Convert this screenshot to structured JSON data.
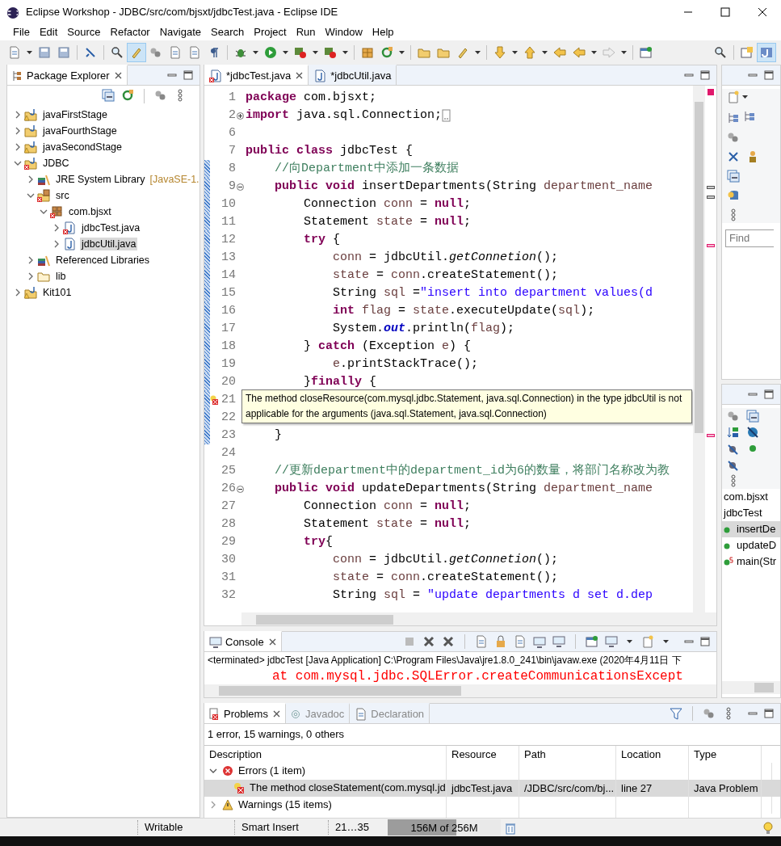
{
  "window": {
    "title": "Eclipse Workshop - JDBC/src/com/bjsxt/jdbcTest.java - Eclipse IDE"
  },
  "menu": [
    "File",
    "Edit",
    "Source",
    "Refactor",
    "Navigate",
    "Search",
    "Project",
    "Run",
    "Window",
    "Help"
  ],
  "package_explorer": {
    "title": "Package Explorer",
    "tree": [
      {
        "label": "javaFirstStage",
        "kind": "project",
        "error": false,
        "warning": true,
        "expanded": false,
        "selected": false
      },
      {
        "label": "javaFourthStage",
        "kind": "project",
        "error": false,
        "warning": false,
        "expanded": false,
        "selected": false
      },
      {
        "label": "javaSecondStage",
        "kind": "project",
        "error": false,
        "warning": true,
        "expanded": false,
        "selected": false
      },
      {
        "label": "JDBC",
        "kind": "project",
        "error": true,
        "warning": false,
        "expanded": true,
        "selected": false,
        "children": [
          {
            "label": "JRE System Library",
            "suffix": "[JavaSE-1.",
            "kind": "library",
            "error": false,
            "warning": false,
            "expanded": false,
            "selected": false
          },
          {
            "label": "src",
            "kind": "source",
            "error": true,
            "warning": false,
            "expanded": true,
            "selected": false,
            "children": [
              {
                "label": "com.bjsxt",
                "kind": "package",
                "error": true,
                "warning": false,
                "expanded": true,
                "selected": false,
                "children": [
                  {
                    "label": "jdbcTest.java",
                    "kind": "java",
                    "error": true,
                    "warning": false,
                    "expanded": false,
                    "selected": false
                  },
                  {
                    "label": "jdbcUtil.java",
                    "kind": "java",
                    "error": false,
                    "warning": false,
                    "expanded": false,
                    "selected": true
                  }
                ]
              }
            ]
          },
          {
            "label": "Referenced Libraries",
            "kind": "library",
            "error": false,
            "warning": false,
            "expanded": false,
            "selected": false
          },
          {
            "label": "lib",
            "kind": "folder",
            "error": false,
            "warning": false,
            "expanded": false,
            "selected": false
          }
        ]
      },
      {
        "label": "Kit101",
        "kind": "project",
        "error": false,
        "warning": true,
        "expanded": false,
        "selected": false
      }
    ]
  },
  "editor": {
    "tabs": [
      {
        "label": "*jdbcTest.java",
        "selected": true,
        "error": true
      },
      {
        "label": "*jdbcUtil.java",
        "selected": false,
        "error": false
      }
    ],
    "lines": [
      {
        "number": "1",
        "changed": false,
        "error": false,
        "code": [
          {
            "kind": "keyword",
            "text": "package"
          },
          {
            "kind": "plain",
            "text": " com.bjsxt;"
          }
        ]
      },
      {
        "number": "2",
        "collapsed": true,
        "changed": false,
        "error": false,
        "code": [
          {
            "kind": "keyword",
            "text": "import"
          },
          {
            "kind": "plain",
            "text": " java.sql.Connection;"
          }
        ]
      },
      {
        "number": "6",
        "changed": false,
        "error": false
      },
      {
        "number": "7",
        "changed": false,
        "error": false,
        "code": [
          {
            "kind": "keyword",
            "text": "public class"
          },
          {
            "kind": "plain",
            "text": " jdbcTest {"
          }
        ]
      },
      {
        "number": "8",
        "changed": true,
        "error": false,
        "code": [
          {
            "kind": "comment",
            "text": "    //向Department中添加一条数据"
          }
        ]
      },
      {
        "number": "9",
        "collapsed": false,
        "changed": true,
        "error": false,
        "code": [
          {
            "kind": "keyword",
            "text": "    public void"
          },
          {
            "kind": "plain",
            "text": " insertDepartments(String "
          },
          {
            "kind": "variable",
            "text": "department_name"
          }
        ]
      },
      {
        "number": "10",
        "changed": true,
        "error": false,
        "code": [
          {
            "kind": "plain",
            "text": "        Connection "
          },
          {
            "kind": "variable",
            "text": "conn"
          },
          {
            "kind": "plain",
            "text": " = "
          },
          {
            "kind": "keyword",
            "text": "null"
          },
          {
            "kind": "plain",
            "text": ";"
          }
        ]
      },
      {
        "number": "11",
        "changed": true,
        "error": false,
        "code": [
          {
            "kind": "plain",
            "text": "        Statement "
          },
          {
            "kind": "variable",
            "text": "state"
          },
          {
            "kind": "plain",
            "text": " = "
          },
          {
            "kind": "keyword",
            "text": "null"
          },
          {
            "kind": "plain",
            "text": ";"
          }
        ]
      },
      {
        "number": "12",
        "changed": true,
        "error": false,
        "code": [
          {
            "kind": "keyword",
            "text": "        try"
          },
          {
            "kind": "plain",
            "text": " {"
          }
        ]
      },
      {
        "number": "13",
        "changed": true,
        "error": false,
        "code": [
          {
            "kind": "variable",
            "text": "            conn"
          },
          {
            "kind": "plain",
            "text": " = jdbcUtil."
          },
          {
            "kind": "method",
            "text": "getConnetion"
          },
          {
            "kind": "plain",
            "text": "();"
          }
        ]
      },
      {
        "number": "14",
        "changed": true,
        "error": false,
        "code": [
          {
            "kind": "variable",
            "text": "            state"
          },
          {
            "kind": "plain",
            "text": " = "
          },
          {
            "kind": "variable",
            "text": "conn"
          },
          {
            "kind": "plain",
            "text": ".createStatement();"
          }
        ]
      },
      {
        "number": "15",
        "changed": true,
        "error": false,
        "code": [
          {
            "kind": "plain",
            "text": "            String "
          },
          {
            "kind": "variable",
            "text": "sql"
          },
          {
            "kind": "plain",
            "text": " ="
          },
          {
            "kind": "string",
            "text": "\"insert into department values(d"
          }
        ]
      },
      {
        "number": "16",
        "changed": true,
        "error": false,
        "code": [
          {
            "kind": "keyword",
            "text": "            int"
          },
          {
            "kind": "variable",
            "text": " flag"
          },
          {
            "kind": "plain",
            "text": " = "
          },
          {
            "kind": "variable",
            "text": "state"
          },
          {
            "kind": "plain",
            "text": ".executeUpdate("
          },
          {
            "kind": "variable",
            "text": "sql"
          },
          {
            "kind": "plain",
            "text": ");"
          }
        ]
      },
      {
        "number": "17",
        "changed": true,
        "error": false,
        "code": [
          {
            "kind": "plain",
            "text": "            System."
          },
          {
            "kind": "field",
            "text": "out"
          },
          {
            "kind": "plain",
            "text": ".println("
          },
          {
            "kind": "variable",
            "text": "flag"
          },
          {
            "kind": "plain",
            "text": ");"
          }
        ]
      },
      {
        "number": "18",
        "changed": true,
        "error": false,
        "code": [
          {
            "kind": "plain",
            "text": "        } "
          },
          {
            "kind": "keyword",
            "text": "catch"
          },
          {
            "kind": "plain",
            "text": " (Exception "
          },
          {
            "kind": "variable",
            "text": "e"
          },
          {
            "kind": "plain",
            "text": ") {"
          }
        ]
      },
      {
        "number": "19",
        "changed": true,
        "error": false,
        "code": [
          {
            "kind": "variable",
            "text": "            e"
          },
          {
            "kind": "plain",
            "text": ".printStackTrace();"
          }
        ]
      },
      {
        "number": "20",
        "changed": true,
        "error": false,
        "code": [
          {
            "kind": "plain",
            "text": "        }"
          },
          {
            "kind": "keyword",
            "text": "finally"
          },
          {
            "kind": "plain",
            "text": " {"
          }
        ]
      },
      {
        "number": "21",
        "changed": true,
        "error": true
      },
      {
        "number": "22",
        "changed": true,
        "error": false
      },
      {
        "number": "23",
        "changed": true,
        "error": false,
        "code": [
          {
            "kind": "plain",
            "text": "    }"
          }
        ]
      },
      {
        "number": "24",
        "changed": false,
        "error": false
      },
      {
        "number": "25",
        "changed": false,
        "error": false,
        "code": [
          {
            "kind": "comment",
            "text": "    //更新department中的department_id为6的数量，将部门名称改为教"
          }
        ]
      },
      {
        "number": "26",
        "collapsed": false,
        "changed": false,
        "error": false,
        "code": [
          {
            "kind": "keyword",
            "text": "    public void"
          },
          {
            "kind": "plain",
            "text": " updateDepartments(String "
          },
          {
            "kind": "variable",
            "text": "department_name"
          }
        ]
      },
      {
        "number": "27",
        "changed": false,
        "error": false,
        "code": [
          {
            "kind": "plain",
            "text": "        Connection "
          },
          {
            "kind": "variable",
            "text": "conn"
          },
          {
            "kind": "plain",
            "text": " = "
          },
          {
            "kind": "keyword",
            "text": "null"
          },
          {
            "kind": "plain",
            "text": ";"
          }
        ]
      },
      {
        "number": "28",
        "changed": false,
        "error": false,
        "code": [
          {
            "kind": "plain",
            "text": "        Statement "
          },
          {
            "kind": "variable",
            "text": "state"
          },
          {
            "kind": "plain",
            "text": " = "
          },
          {
            "kind": "keyword",
            "text": "null"
          },
          {
            "kind": "plain",
            "text": ";"
          }
        ]
      },
      {
        "number": "29",
        "changed": false,
        "error": false,
        "code": [
          {
            "kind": "keyword",
            "text": "        try"
          },
          {
            "kind": "plain",
            "text": "{"
          }
        ]
      },
      {
        "number": "30",
        "changed": false,
        "error": false,
        "code": [
          {
            "kind": "variable",
            "text": "            conn"
          },
          {
            "kind": "plain",
            "text": " = jdbcUtil."
          },
          {
            "kind": "method",
            "text": "getConnetion"
          },
          {
            "kind": "plain",
            "text": "();"
          }
        ]
      },
      {
        "number": "31",
        "changed": false,
        "error": false,
        "code": [
          {
            "kind": "variable",
            "text": "            state"
          },
          {
            "kind": "plain",
            "text": " = "
          },
          {
            "kind": "variable",
            "text": "conn"
          },
          {
            "kind": "plain",
            "text": ".createStatement();"
          }
        ]
      },
      {
        "number": "32",
        "changed": false,
        "error": false,
        "code": [
          {
            "kind": "plain",
            "text": "            String "
          },
          {
            "kind": "variable",
            "text": "sql"
          },
          {
            "kind": "plain",
            "text": " = "
          },
          {
            "kind": "string",
            "text": "\"update departments d set d.dep"
          }
        ]
      }
    ],
    "tooltip": "The method closeResource(com.mysql.jdbc.Statement, java.sql.Connection) in the type jdbcUtil is not applicable for the arguments (java.sql.Statement, java.sql.Connection)"
  },
  "task_view": {
    "find_placeholder": "Find"
  },
  "outline": {
    "items": [
      {
        "label": "com.bjsxt",
        "kind": "package",
        "selected": false
      },
      {
        "label": "jdbcTest",
        "kind": "class",
        "selected": false
      },
      {
        "label": "insertDe",
        "kind": "method",
        "selected": true
      },
      {
        "label": "updateD",
        "kind": "method",
        "selected": false
      },
      {
        "label": "main(Str",
        "kind": "static-method",
        "selected": false
      }
    ]
  },
  "console": {
    "title": "Console",
    "process": "<terminated> jdbcTest [Java Application] C:\\Program Files\\Java\\jre1.8.0_241\\bin\\javaw.exe (2020年4月11日 下",
    "output": "at com.mysql.jdbc.SQLError.createCommunicationsExcept"
  },
  "problems": {
    "tabs": [
      {
        "label": "Problems",
        "selected": true
      },
      {
        "label": "Javadoc",
        "selected": false
      },
      {
        "label": "Declaration",
        "selected": false
      }
    ],
    "summary": "1 error, 15 warnings, 0 others",
    "columns": [
      "Description",
      "Resource",
      "Path",
      "Location",
      "Type"
    ],
    "groups": [
      {
        "label": "Errors (1 item)",
        "kind": "error",
        "expanded": true,
        "rows": [
          {
            "cells": [
              "The method closeStatement(com.mysql.jd",
              "jdbcTest.java",
              "/JDBC/src/com/bj...",
              "line 27",
              "Java Problem"
            ],
            "selected": true
          }
        ]
      },
      {
        "label": "Warnings (15 items)",
        "kind": "warning",
        "expanded": false
      }
    ]
  },
  "status_bar": {
    "mode": "Writable",
    "insert": "Smart Insert",
    "position": "21…35",
    "memory": {
      "text": "156M of 256M",
      "level": 0.61
    }
  }
}
